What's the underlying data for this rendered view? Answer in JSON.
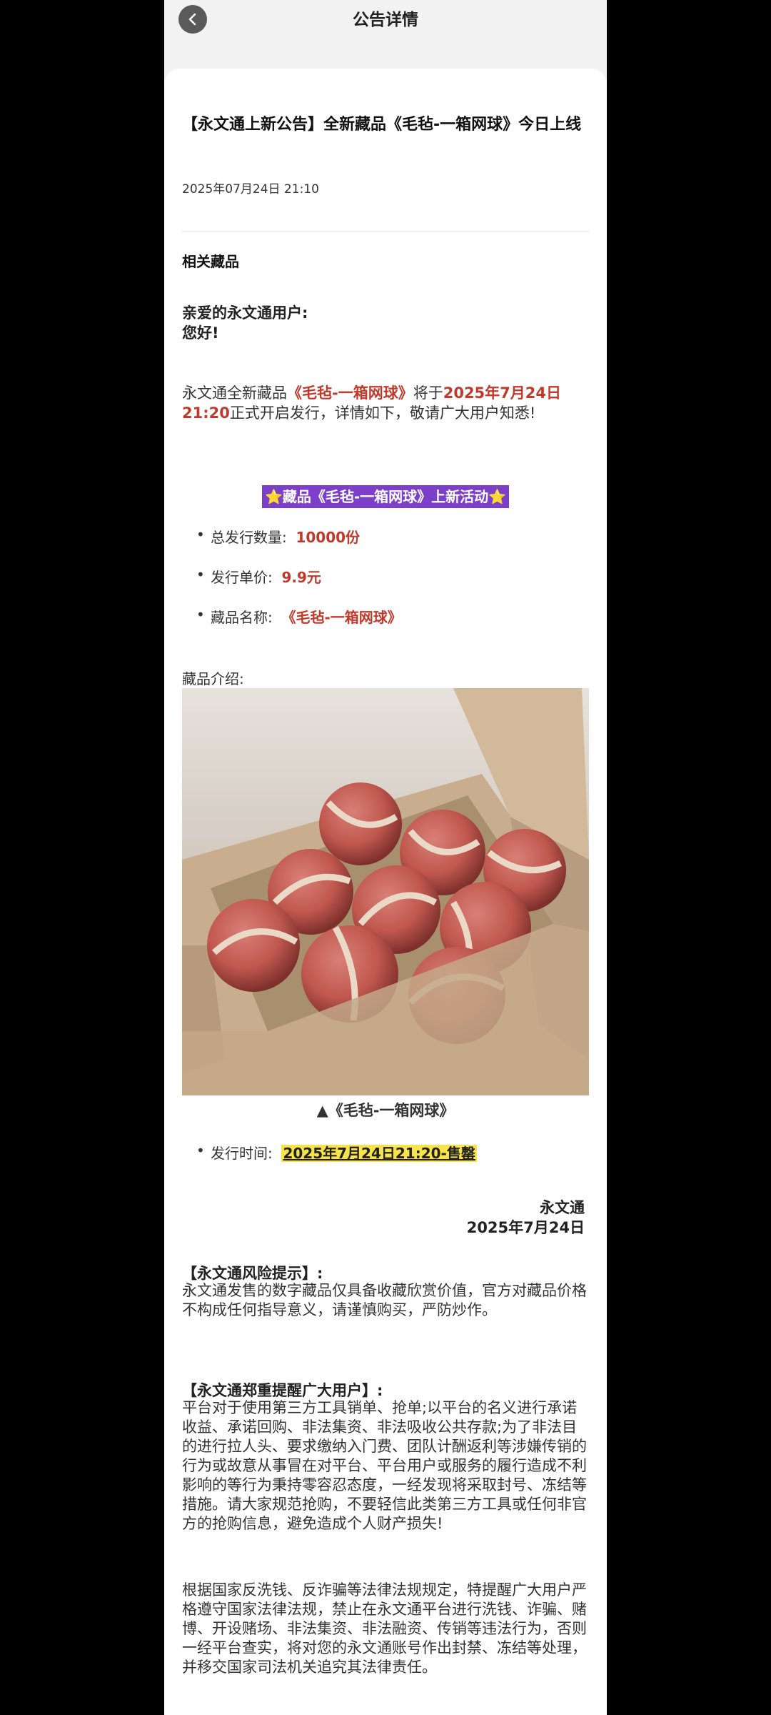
{
  "header": {
    "title": "公告详情"
  },
  "article": {
    "headline": "【永文通上新公告】全新藏品《毛毡-一箱网球》今日上线",
    "date": "2025年07月24日 21:10",
    "related_label": "相关藏品",
    "greeting_line1": "亲爱的永文通用户:",
    "greeting_line2": "您好!",
    "intro_part1": "永文通全新藏品",
    "intro_name": "《毛毡-一箱网球》",
    "intro_part2": "将于",
    "intro_time": "2025年7月24日21:20",
    "intro_part3": "正式开启发行，详情如下，敬请广大用户知悉!",
    "activity_star": "⭐",
    "activity_title": "藏品《毛毡-一箱网球》上新活动",
    "bullets": [
      {
        "label": "总发行数量:",
        "value": "10000份"
      },
      {
        "label": "发行单价:",
        "value": "9.9元"
      },
      {
        "label": "藏品名称:",
        "value": "《毛毡-一箱网球》"
      }
    ],
    "intro_label": "藏品介绍:",
    "image_caption": "▲《毛毡-一箱网球》",
    "release_label": "发行时间:",
    "release_value": "2025年7月24日21:20-售罄",
    "sign_name": "永文通",
    "sign_date": "2025年7月24日",
    "risk_title": "【永文通风险提示】:",
    "risk_body": "永文通发售的数字藏品仅具备收藏欣赏价值，官方对藏品价格不构成任何指导意义，请谨慎购买，严防炒作。",
    "warn_title": "【永文通郑重提醒广大用户】:",
    "warn_body": "平台对于使用第三方工具销单、抢单;以平台的名义进行承诺收益、承诺回购、非法集资、非法吸收公共存款;为了非法目的进行拉人头、要求缴纳入门费、团队计酬返利等涉嫌传销的行为或故意从事冒在对平台、平台用户或服务的履行造成不利影响的等行为秉持零容忍态度，一经发现将采取封号、冻结等措施。请大家规范抢购，不要轻信此类第三方工具或任何非官方的抢购信息，避免造成个人财产损失!",
    "law_body": "根据国家反洗钱、反诈骗等法律法规规定，特提醒广大用户严格遵守国家法律法规，禁止在永文通平台进行洗钱、诈骗、赌博、开设赌场、非法集资、非法融资、传销等违法行为，否则一经平台查实，将对您的永文通账号作出封禁、冻结等处理，并移交国家司法机关追究其法律责任。"
  },
  "colors": {
    "accent_red": "#c0392b",
    "activity_bg": "#7b3fc9",
    "highlight": "#f7e34a"
  }
}
